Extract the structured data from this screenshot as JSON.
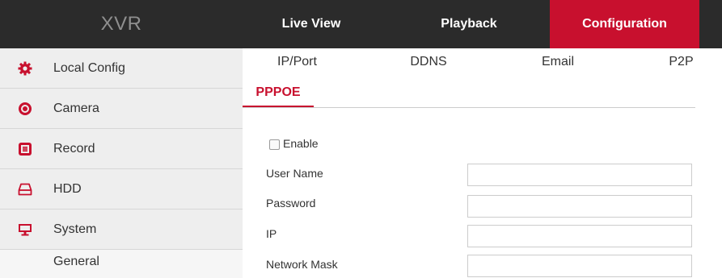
{
  "header": {
    "brand": "XVR",
    "nav": [
      {
        "label": "Live View"
      },
      {
        "label": "Playback"
      },
      {
        "label": "Configuration",
        "active": true
      }
    ],
    "active_color": "#c8102e"
  },
  "sidebar": {
    "items": [
      {
        "label": "Local Config",
        "icon": "gear-icon"
      },
      {
        "label": "Camera",
        "icon": "camera-icon"
      },
      {
        "label": "Record",
        "icon": "record-icon"
      },
      {
        "label": "HDD",
        "icon": "hdd-icon"
      },
      {
        "label": "System",
        "icon": "monitor-icon"
      }
    ],
    "sub_items": [
      {
        "label": "General"
      }
    ]
  },
  "main": {
    "tabs": [
      {
        "label": "IP/Port"
      },
      {
        "label": "DDNS"
      },
      {
        "label": "Email"
      },
      {
        "label": "P2P"
      }
    ],
    "section_tab": "PPPOE",
    "enable": {
      "label": "Enable",
      "checked": false
    },
    "fields": [
      {
        "label": "User Name",
        "value": ""
      },
      {
        "label": "Password",
        "value": ""
      },
      {
        "label": "IP",
        "value": ""
      },
      {
        "label": "Network Mask",
        "value": ""
      }
    ]
  }
}
